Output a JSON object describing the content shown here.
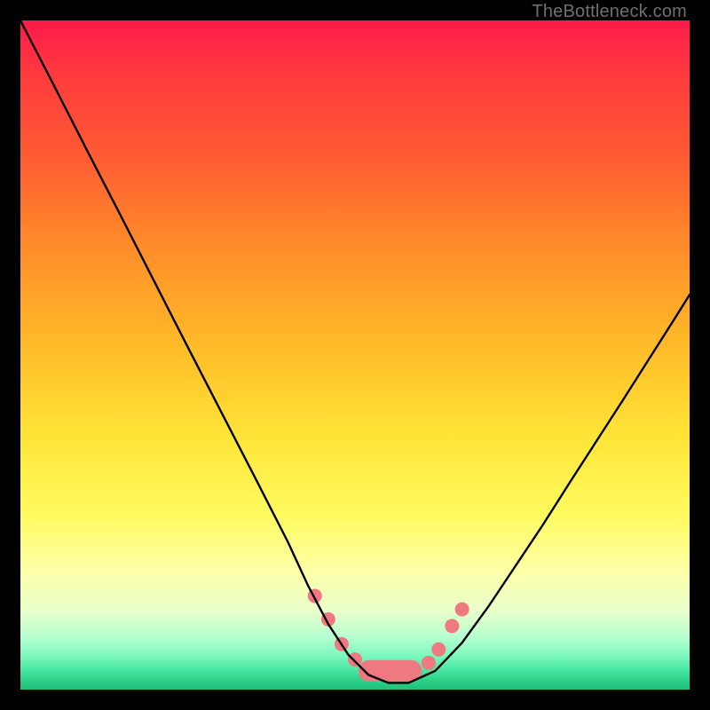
{
  "watermark": "TheBottleneck.com",
  "chart_data": {
    "type": "line",
    "title": "",
    "xlabel": "",
    "ylabel": "",
    "xlim": [
      0,
      100
    ],
    "ylim": [
      0,
      100
    ],
    "grid": false,
    "series": [
      {
        "name": "bottleneck-curve",
        "color": "#000000",
        "x": [
          0,
          5,
          10,
          15,
          20,
          25,
          30,
          35,
          40,
          43,
          46,
          49,
          52,
          55,
          58,
          62,
          66,
          70,
          74,
          78,
          82,
          86,
          90,
          94,
          98,
          100
        ],
        "y": [
          100,
          90.3,
          80.5,
          70.8,
          61.0,
          51.2,
          41.5,
          31.8,
          22.0,
          15.5,
          9.8,
          5.2,
          2.2,
          1.0,
          1.0,
          2.8,
          7.0,
          12.5,
          18.5,
          24.5,
          30.8,
          37.0,
          43.2,
          49.5,
          55.8,
          59.0
        ]
      }
    ],
    "markers": {
      "name": "highlight-markers",
      "color": "#ef7981",
      "radius_px": 8,
      "points": [
        {
          "x": 44.0,
          "y": 14.0
        },
        {
          "x": 46.0,
          "y": 10.5
        },
        {
          "x": 48.0,
          "y": 6.8
        },
        {
          "x": 50.0,
          "y": 4.5
        },
        {
          "x": 52.0,
          "y": 3.2
        },
        {
          "x": 54.5,
          "y": 2.6
        },
        {
          "x": 61.0,
          "y": 4.0
        },
        {
          "x": 62.5,
          "y": 6.0
        },
        {
          "x": 64.5,
          "y": 9.5
        },
        {
          "x": 66.0,
          "y": 12.0
        }
      ],
      "band_segments": [
        {
          "x1": 50.5,
          "x2": 60.0,
          "y": 2.8,
          "height": 3.2
        }
      ]
    },
    "background_gradient_stops": [
      {
        "pos": 0.0,
        "color": "#ff1a4a"
      },
      {
        "pos": 0.2,
        "color": "#ff5a33"
      },
      {
        "pos": 0.48,
        "color": "#ffb928"
      },
      {
        "pos": 0.74,
        "color": "#fffb60"
      },
      {
        "pos": 0.88,
        "color": "#eaffc9"
      },
      {
        "pos": 1.0,
        "color": "#1fc07a"
      }
    ]
  }
}
